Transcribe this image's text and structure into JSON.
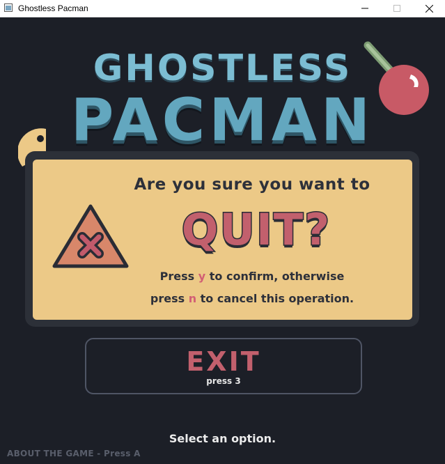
{
  "window": {
    "title": "Ghostless Pacman",
    "minimize_icon": "minimize-icon",
    "maximize_icon": "maximize-icon",
    "close_icon": "close-icon"
  },
  "logo": {
    "line1": "GHOSTLESS",
    "line2": "PACMAN"
  },
  "dialog": {
    "icon": "warning-x-icon",
    "line1": "Are you sure you want to",
    "headline": "QUIT?",
    "hint1_before": "Press ",
    "hint1_key": "y",
    "hint1_after": " to confirm, otherwise",
    "hint2_before": "press ",
    "hint2_key": "n",
    "hint2_after": " to cancel this operation."
  },
  "exit_button": {
    "label": "EXIT",
    "sublabel": "press 3"
  },
  "footer": {
    "prompt": "Select an option.",
    "about": "ABOUT THE GAME - Press A"
  },
  "colors": {
    "background": "#1c1f27",
    "logo_blue": "#63a7bf",
    "dialog_bg": "#ecc987",
    "accent_red": "#c2606d",
    "warning_fill": "#d8876a",
    "cherry_red": "#c85a66",
    "pacman_yellow": "#ecc987"
  }
}
